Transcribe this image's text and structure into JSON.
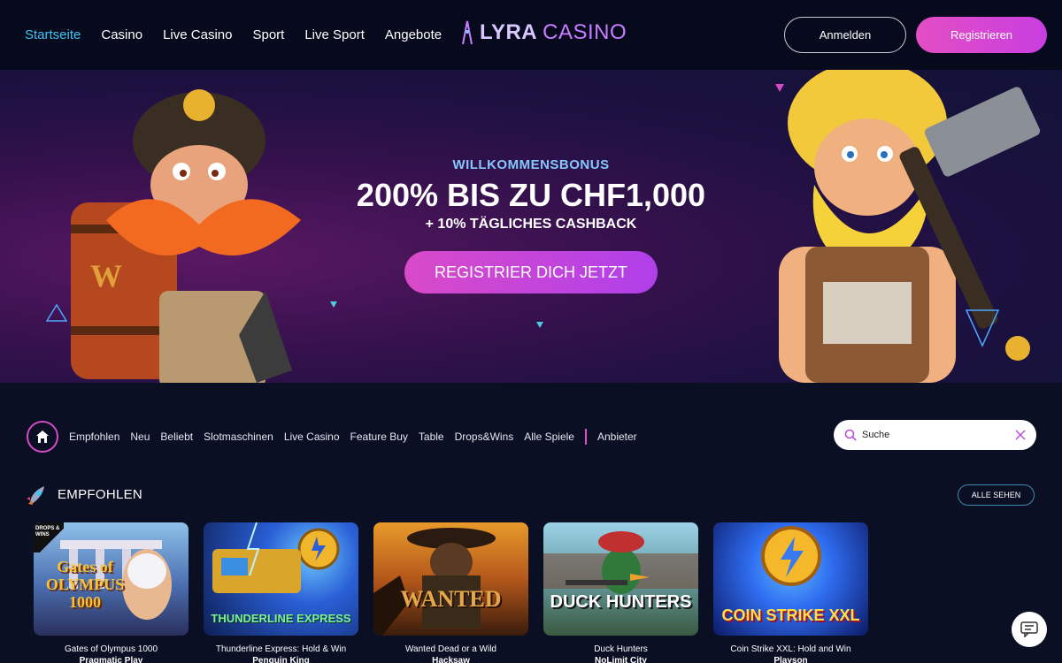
{
  "header": {
    "nav": [
      "Startseite",
      "Casino",
      "Live Casino",
      "Sport",
      "Live Sport",
      "Angebote"
    ],
    "logo_a": "LYRA",
    "logo_b": "CASINO",
    "login": "Anmelden",
    "register": "Registrieren"
  },
  "hero": {
    "kicker": "WILLKOMMENSBONUS",
    "headline": "200% BIS ZU CHF1,000",
    "subline": "+ 10% TÄGLICHES CASHBACK",
    "cta": "REGISTRIER DICH JETZT"
  },
  "filters": {
    "items": [
      "Empfohlen",
      "Neu",
      "Beliebt",
      "Slotmaschinen",
      "Live Casino",
      "Feature Buy",
      "Table",
      "Drops&Wins",
      "Alle Spiele"
    ],
    "providers": "Anbieter",
    "search_placeholder": "Suche"
  },
  "section": {
    "title": "EMPFOHLEN",
    "see_all": "ALLE SEHEN"
  },
  "games": [
    {
      "title": "Gates of Olympus 1000",
      "provider": "Pragmatic Play",
      "badge": "DROPS & WINS",
      "art": "Gates of OLYMPUS 1000",
      "color1": "#6aa6d9",
      "color2": "#2e3d7a"
    },
    {
      "title": "Thunderline Express: Hold & Win",
      "provider": "Penguin King",
      "art": "THUNDERLINE EXPRESS",
      "color1": "#2a5fd6",
      "color2": "#0e1f55"
    },
    {
      "title": "Wanted Dead or a Wild",
      "provider": "Hacksaw",
      "art": "WANTED",
      "color1": "#e0a12b",
      "color2": "#3a2010"
    },
    {
      "title": "Duck Hunters",
      "provider": "NoLimit City",
      "art": "DUCK HUNTERS",
      "color1": "#7fc0d8",
      "color2": "#2c4a3e"
    },
    {
      "title": "Coin Strike XXL: Hold and Win",
      "provider": "Playson",
      "art": "COIN STRIKE XXL",
      "color1": "#2f6cf0",
      "color2": "#0c1a66"
    }
  ],
  "colors": {
    "accent": "#3fc3f0",
    "pink": "#e04fc8",
    "bg": "#0b0f24"
  }
}
